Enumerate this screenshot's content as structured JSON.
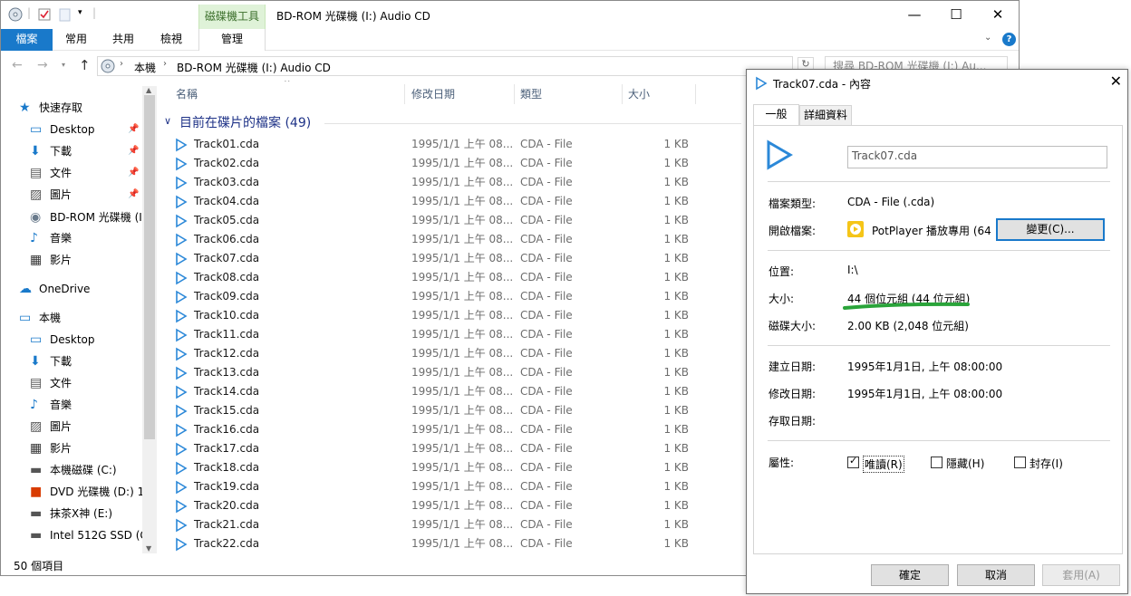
{
  "explorer": {
    "window_title": "BD-ROM 光碟機 (I:) Audio CD",
    "context_tab_group": "磁碟機工具",
    "ribbon_tabs": [
      "檔案",
      "常用",
      "共用",
      "檢視",
      "管理"
    ],
    "breadcrumb": [
      "本機",
      "BD-ROM 光碟機 (I:) Audio CD"
    ],
    "search_placeholder": "搜尋 BD-ROM 光碟機 (I:) Au...",
    "columns": [
      "名稱",
      "修改日期",
      "類型",
      "大小"
    ],
    "group_header": "目前在碟片的檔案 (49)",
    "nav": [
      {
        "label": "快速存取",
        "icon": "star-icon",
        "pin": false
      },
      {
        "label": "Desktop",
        "icon": "desktop-icon",
        "pin": true
      },
      {
        "label": "下載",
        "icon": "download-icon",
        "pin": true
      },
      {
        "label": "文件",
        "icon": "document-icon",
        "pin": true
      },
      {
        "label": "圖片",
        "icon": "pictures-icon",
        "pin": true
      },
      {
        "label": "BD-ROM 光碟機 (I",
        "icon": "disc-icon",
        "pin": false
      },
      {
        "label": "音樂",
        "icon": "music-icon",
        "pin": false
      },
      {
        "label": "影片",
        "icon": "video-icon",
        "pin": false
      },
      {
        "label": "OneDrive",
        "icon": "cloud-icon",
        "pin": false
      },
      {
        "label": "本機",
        "icon": "computer-icon",
        "pin": false
      },
      {
        "label": "Desktop",
        "icon": "desktop-icon",
        "pin": false
      },
      {
        "label": "下載",
        "icon": "download-icon",
        "pin": false
      },
      {
        "label": "文件",
        "icon": "document-icon",
        "pin": false
      },
      {
        "label": "音樂",
        "icon": "music-icon",
        "pin": false
      },
      {
        "label": "圖片",
        "icon": "pictures-icon",
        "pin": false
      },
      {
        "label": "影片",
        "icon": "video-icon",
        "pin": false
      },
      {
        "label": "本機磁碟 (C:)",
        "icon": "drive-icon",
        "pin": false
      },
      {
        "label": "DVD 光碟機 (D:) 1(",
        "icon": "office-icon",
        "pin": false
      },
      {
        "label": "抹茶X神 (E:)",
        "icon": "drive-icon",
        "pin": false
      },
      {
        "label": "Intel 512G SSD (G",
        "icon": "drive-icon",
        "pin": false
      }
    ],
    "files": [
      {
        "name": "Track01.cda",
        "date": "1995/1/1 上午 08...",
        "type": "CDA - File",
        "size": "1 KB"
      },
      {
        "name": "Track02.cda",
        "date": "1995/1/1 上午 08...",
        "type": "CDA - File",
        "size": "1 KB"
      },
      {
        "name": "Track03.cda",
        "date": "1995/1/1 上午 08...",
        "type": "CDA - File",
        "size": "1 KB"
      },
      {
        "name": "Track04.cda",
        "date": "1995/1/1 上午 08...",
        "type": "CDA - File",
        "size": "1 KB"
      },
      {
        "name": "Track05.cda",
        "date": "1995/1/1 上午 08...",
        "type": "CDA - File",
        "size": "1 KB"
      },
      {
        "name": "Track06.cda",
        "date": "1995/1/1 上午 08...",
        "type": "CDA - File",
        "size": "1 KB"
      },
      {
        "name": "Track07.cda",
        "date": "1995/1/1 上午 08...",
        "type": "CDA - File",
        "size": "1 KB"
      },
      {
        "name": "Track08.cda",
        "date": "1995/1/1 上午 08...",
        "type": "CDA - File",
        "size": "1 KB"
      },
      {
        "name": "Track09.cda",
        "date": "1995/1/1 上午 08...",
        "type": "CDA - File",
        "size": "1 KB"
      },
      {
        "name": "Track10.cda",
        "date": "1995/1/1 上午 08...",
        "type": "CDA - File",
        "size": "1 KB"
      },
      {
        "name": "Track11.cda",
        "date": "1995/1/1 上午 08...",
        "type": "CDA - File",
        "size": "1 KB"
      },
      {
        "name": "Track12.cda",
        "date": "1995/1/1 上午 08...",
        "type": "CDA - File",
        "size": "1 KB"
      },
      {
        "name": "Track13.cda",
        "date": "1995/1/1 上午 08...",
        "type": "CDA - File",
        "size": "1 KB"
      },
      {
        "name": "Track14.cda",
        "date": "1995/1/1 上午 08...",
        "type": "CDA - File",
        "size": "1 KB"
      },
      {
        "name": "Track15.cda",
        "date": "1995/1/1 上午 08...",
        "type": "CDA - File",
        "size": "1 KB"
      },
      {
        "name": "Track16.cda",
        "date": "1995/1/1 上午 08...",
        "type": "CDA - File",
        "size": "1 KB"
      },
      {
        "name": "Track17.cda",
        "date": "1995/1/1 上午 08...",
        "type": "CDA - File",
        "size": "1 KB"
      },
      {
        "name": "Track18.cda",
        "date": "1995/1/1 上午 08...",
        "type": "CDA - File",
        "size": "1 KB"
      },
      {
        "name": "Track19.cda",
        "date": "1995/1/1 上午 08...",
        "type": "CDA - File",
        "size": "1 KB"
      },
      {
        "name": "Track20.cda",
        "date": "1995/1/1 上午 08...",
        "type": "CDA - File",
        "size": "1 KB"
      },
      {
        "name": "Track21.cda",
        "date": "1995/1/1 上午 08...",
        "type": "CDA - File",
        "size": "1 KB"
      },
      {
        "name": "Track22.cda",
        "date": "1995/1/1 上午 08...",
        "type": "CDA - File",
        "size": "1 KB"
      }
    ],
    "status": "50 個項目"
  },
  "dialog": {
    "title": "Track07.cda - 內容",
    "tabs": [
      "一般",
      "詳細資料"
    ],
    "filename": "Track07.cda",
    "type_label": "檔案類型:",
    "type_value": "CDA - File (.cda)",
    "opens_label": "開啟檔案:",
    "opens_value": "PotPlayer 播放專用 (64",
    "change_button": "變更(C)...",
    "location_label": "位置:",
    "location_value": "I:\\",
    "size_label": "大小:",
    "size_value": "44 個位元組 (44 位元組)",
    "disk_size_label": "磁碟大小:",
    "disk_size_value": "2.00 KB (2,048 位元組)",
    "created_label": "建立日期:",
    "created_value": "1995年1月1日, 上午 08:00:00",
    "modified_label": "修改日期:",
    "modified_value": "1995年1月1日, 上午 08:00:00",
    "accessed_label": "存取日期:",
    "attributes_label": "屬性:",
    "attributes": [
      {
        "label": "唯讀(R)",
        "checked": true
      },
      {
        "label": "隱藏(H)",
        "checked": false
      },
      {
        "label": "封存(I)",
        "checked": false
      }
    ],
    "buttons": {
      "ok": "確定",
      "cancel": "取消",
      "apply": "套用(A)"
    }
  },
  "colors": {
    "accent": "#1979ca",
    "highlight": "#2aa43a",
    "file_icon": "#2b88d8"
  }
}
